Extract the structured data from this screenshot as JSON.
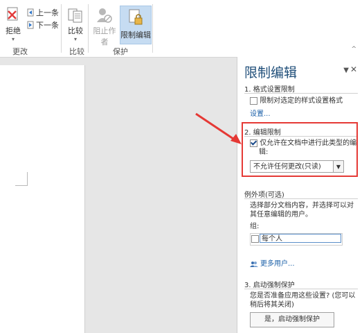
{
  "ribbon": {
    "reject_label": "拒绝",
    "prev_label": "上一条",
    "next_label": "下一条",
    "compare_label": "比较",
    "block_authors_label": "阻止作者",
    "restrict_editing_label": "限制编辑",
    "groups": {
      "changes": "更改",
      "compare": "比较",
      "protect": "保护"
    }
  },
  "pane": {
    "title": "限制编辑",
    "section1": {
      "heading": "1. 格式设置限制",
      "checkbox_label": "限制对选定的样式设置格式",
      "checked": false,
      "settings_link": "设置..."
    },
    "section2": {
      "heading": "2. 编辑限制",
      "checkbox_label_line1": "仅允许在文档中进行此类型的编",
      "checkbox_label_line2": "辑:",
      "checked": true,
      "select_value": "不允许任何更改(只读)"
    },
    "exceptions": {
      "heading": "例外项(可选)",
      "description_line1": "选择部分文档内容，并选择可以对",
      "description_line2": "其任意编辑的用户。",
      "groups_label": "组:",
      "everyone": "每个人",
      "more_users_link": "更多用户..."
    },
    "section3": {
      "heading": "3. 启动强制保护",
      "description_line1": "您是否准备应用这些设置? (您可以",
      "description_line2": "稍后将其关闭)",
      "start_button": "是，启动强制保护"
    }
  },
  "colors": {
    "accent_blue": "#1f4e79",
    "link_blue": "#1a5fa8",
    "highlight_red": "#e53935",
    "selected_ribbon": "#c6dcf2"
  }
}
